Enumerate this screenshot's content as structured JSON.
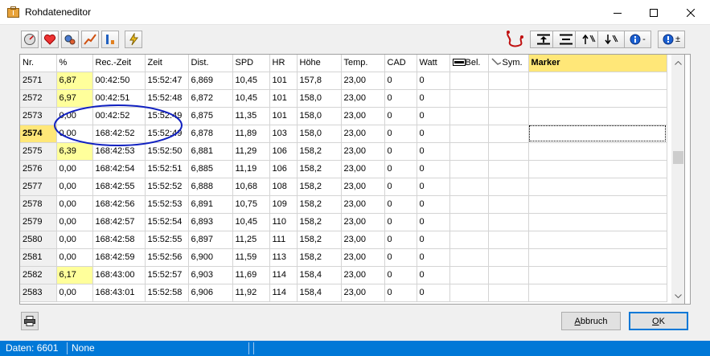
{
  "window": {
    "title": "Rohdateneditor",
    "minimize_icon": "minimize-icon",
    "maximize_icon": "maximize-icon",
    "close_icon": "close-icon"
  },
  "toolbar": {
    "left_icons": [
      "speedometer-icon",
      "heart-icon",
      "gears-icon",
      "climb-icon",
      "lap-icon",
      "lightning-icon"
    ],
    "right_icons": [
      "route-icon",
      "align-top-icon",
      "align-center-icon",
      "sort-up-icon",
      "sort-down-icon",
      "info-minus-icon",
      "info-plus-icon"
    ],
    "info_minus_label": "-",
    "info_plus_label": "±"
  },
  "grid": {
    "columns": [
      "Nr.",
      "%",
      "Rec.-Zeit",
      "Zeit",
      "Dist.",
      "SPD",
      "HR",
      "Höhe",
      "Temp.",
      "CAD",
      "Watt",
      "Bel.",
      "Sym.",
      "Marker"
    ],
    "rows": [
      {
        "nr": "2571",
        "pct": "6,87",
        "rec": "00:42:50",
        "zeit": "15:52:47",
        "dist": "6,869",
        "spd": "10,45",
        "hr": "101",
        "hoehe": "157,8",
        "temp": "23,00",
        "cad": "0",
        "watt": "0",
        "pct_hl": true
      },
      {
        "nr": "2572",
        "pct": "6,97",
        "rec": "00:42:51",
        "zeit": "15:52:48",
        "dist": "6,872",
        "spd": "10,45",
        "hr": "101",
        "hoehe": "158,0",
        "temp": "23,00",
        "cad": "0",
        "watt": "0",
        "pct_hl": true
      },
      {
        "nr": "2573",
        "pct": "0,00",
        "rec": "00:42:52",
        "zeit": "15:52:49",
        "dist": "6,875",
        "spd": "11,35",
        "hr": "101",
        "hoehe": "158,0",
        "temp": "23,00",
        "cad": "0",
        "watt": "0",
        "pct_hl": false
      },
      {
        "nr": "2574",
        "pct": "0,00",
        "rec": "168:42:52",
        "zeit": "15:52:49",
        "dist": "6,878",
        "spd": "11,89",
        "hr": "103",
        "hoehe": "158,0",
        "temp": "23,00",
        "cad": "0",
        "watt": "0",
        "pct_hl": false,
        "current": true
      },
      {
        "nr": "2575",
        "pct": "6,39",
        "rec": "168:42:53",
        "zeit": "15:52:50",
        "dist": "6,881",
        "spd": "11,29",
        "hr": "106",
        "hoehe": "158,2",
        "temp": "23,00",
        "cad": "0",
        "watt": "0",
        "pct_hl": true
      },
      {
        "nr": "2576",
        "pct": "0,00",
        "rec": "168:42:54",
        "zeit": "15:52:51",
        "dist": "6,885",
        "spd": "11,19",
        "hr": "106",
        "hoehe": "158,2",
        "temp": "23,00",
        "cad": "0",
        "watt": "0",
        "pct_hl": false
      },
      {
        "nr": "2577",
        "pct": "0,00",
        "rec": "168:42:55",
        "zeit": "15:52:52",
        "dist": "6,888",
        "spd": "10,68",
        "hr": "108",
        "hoehe": "158,2",
        "temp": "23,00",
        "cad": "0",
        "watt": "0",
        "pct_hl": false
      },
      {
        "nr": "2578",
        "pct": "0,00",
        "rec": "168:42:56",
        "zeit": "15:52:53",
        "dist": "6,891",
        "spd": "10,75",
        "hr": "109",
        "hoehe": "158,2",
        "temp": "23,00",
        "cad": "0",
        "watt": "0",
        "pct_hl": false
      },
      {
        "nr": "2579",
        "pct": "0,00",
        "rec": "168:42:57",
        "zeit": "15:52:54",
        "dist": "6,893",
        "spd": "10,45",
        "hr": "110",
        "hoehe": "158,2",
        "temp": "23,00",
        "cad": "0",
        "watt": "0",
        "pct_hl": false
      },
      {
        "nr": "2580",
        "pct": "0,00",
        "rec": "168:42:58",
        "zeit": "15:52:55",
        "dist": "6,897",
        "spd": "11,25",
        "hr": "111",
        "hoehe": "158,2",
        "temp": "23,00",
        "cad": "0",
        "watt": "0",
        "pct_hl": false
      },
      {
        "nr": "2581",
        "pct": "0,00",
        "rec": "168:42:59",
        "zeit": "15:52:56",
        "dist": "6,900",
        "spd": "11,59",
        "hr": "113",
        "hoehe": "158,2",
        "temp": "23,00",
        "cad": "0",
        "watt": "0",
        "pct_hl": false
      },
      {
        "nr": "2582",
        "pct": "6,17",
        "rec": "168:43:00",
        "zeit": "15:52:57",
        "dist": "6,903",
        "spd": "11,69",
        "hr": "114",
        "hoehe": "158,4",
        "temp": "23,00",
        "cad": "0",
        "watt": "0",
        "pct_hl": true
      },
      {
        "nr": "2583",
        "pct": "0,00",
        "rec": "168:43:01",
        "zeit": "15:52:58",
        "dist": "6,906",
        "spd": "11,92",
        "hr": "114",
        "hoehe": "158,4",
        "temp": "23,00",
        "cad": "0",
        "watt": "0",
        "pct_hl": false
      }
    ]
  },
  "buttons": {
    "cancel_underlined": "A",
    "cancel_rest": "bbruch",
    "ok_underlined": "O",
    "ok_rest": "K",
    "print_icon": "printer-icon"
  },
  "status": {
    "count": "Daten: 6601",
    "mode": "None"
  },
  "colors": {
    "highlight": "#ffff9b",
    "current_row": "#ffe778",
    "marker_header": "#ffe778",
    "statusbar": "#0078d7",
    "annotation": "#1020c0"
  }
}
